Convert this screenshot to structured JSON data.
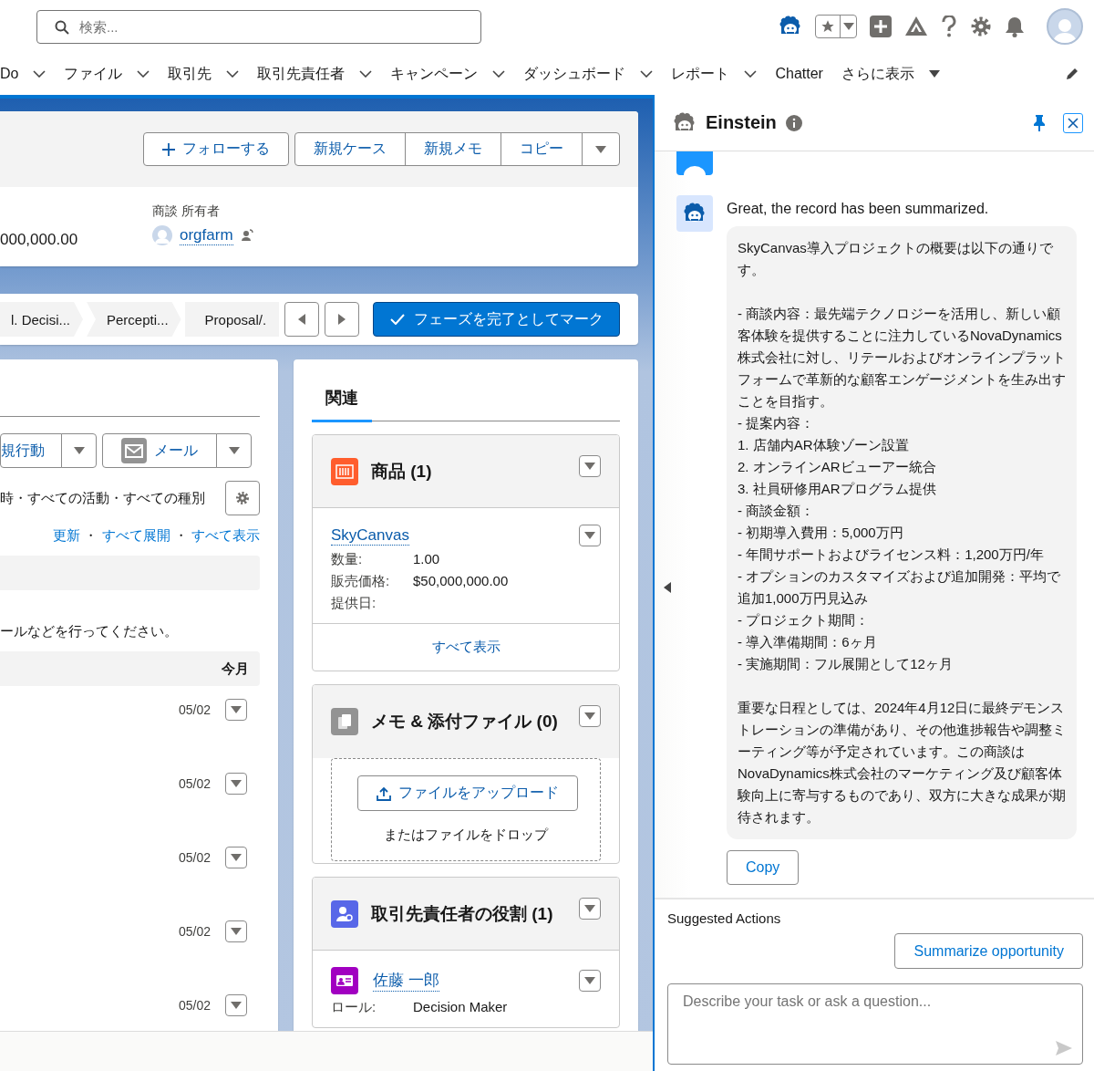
{
  "search": {
    "placeholder": "検索..."
  },
  "nav": [
    {
      "label": "Do",
      "kind": "dropdown"
    },
    {
      "label": "ファイル",
      "kind": "dropdown"
    },
    {
      "label": "取引先",
      "kind": "dropdown"
    },
    {
      "label": "取引先責任者",
      "kind": "dropdown"
    },
    {
      "label": "キャンペーン",
      "kind": "dropdown"
    },
    {
      "label": "ダッシュボード",
      "kind": "dropdown"
    },
    {
      "label": "レポート",
      "kind": "dropdown"
    },
    {
      "label": "Chatter",
      "kind": "plain"
    },
    {
      "label": "さらに表示",
      "kind": "more"
    }
  ],
  "record_actions": {
    "follow": "フォローする",
    "buttons": [
      "新規ケース",
      "新規メモ",
      "コピー"
    ]
  },
  "highlights": {
    "amount": "000,000.00",
    "owner_label": "商談 所有者",
    "owner_name": "orgfarm"
  },
  "path": {
    "stages": [
      "l. Decisi...",
      "Percepti...",
      "Proposal/."
    ],
    "mark_button": "フェーズを完了としてマーク"
  },
  "activity": {
    "buttons": [
      {
        "label": "規行動",
        "kind": "plain"
      },
      {
        "label": "メール",
        "kind": "email"
      }
    ],
    "filter": "時・すべての活動・すべての種別",
    "links": [
      "更新",
      "すべて展開",
      "すべて表示"
    ],
    "link_separators": [
      "・",
      "・"
    ],
    "empty_text": "ールなどを行ってください。",
    "group_label": "今月",
    "items": [
      "05/02",
      "05/02",
      "05/02",
      "05/02",
      "05/02"
    ]
  },
  "related": {
    "tabs": [
      {
        "label": "関連",
        "selected": true
      }
    ],
    "cards": [
      {
        "kind": "records",
        "title": "商品 (1)",
        "records": [
          {
            "name": "SkyCanvas",
            "fields": [
              {
                "label": "数量:",
                "value": "1.00"
              },
              {
                "label": "販売価格:",
                "value": "$50,000,000.00"
              },
              {
                "label": "提供日:"
              }
            ]
          }
        ],
        "footer": "すべて表示"
      },
      {
        "kind": "files",
        "title": "メモ & 添付ファイル (0)",
        "upload": "ファイルをアップロード",
        "drop_text": "またはファイルをドロップ"
      },
      {
        "kind": "records",
        "title": "取引先責任者の役割 (1)",
        "records": [
          {
            "name": "佐藤 一郎",
            "fields": [
              {
                "label": "ロール:",
                "value": "Decision Maker"
              }
            ]
          }
        ]
      }
    ]
  },
  "einstein": {
    "title": "Einstein",
    "reply": "Great, the record has been summarized.",
    "summary": [
      {
        "kind": "paragraph",
        "text": "SkyCanvas導入プロジェクトの概要は以下の通りです。"
      },
      {
        "kind": "list",
        "lines": [
          "- 商談内容：最先端テクノロジーを活用し、新しい顧客体験を提供することに注力しているNovaDynamics株式会社に対し、リテールおよびオンラインプラットフォームで革新的な顧客エンゲージメントを生み出すことを目指す。",
          "- 提案内容：",
          "1. 店舗内AR体験ゾーン設置",
          "2. オンラインARビューアー統合",
          "3. 社員研修用ARプログラム提供",
          "- 商談金額：",
          "- 初期導入費用：5,000万円",
          "- 年間サポートおよびライセンス料：1,200万円/年",
          "- オプションのカスタマイズおよび追加開発：平均で追加1,000万円見込み",
          "- プロジェクト期間：",
          "- 導入準備期間：6ヶ月",
          "- 実施期間：フル展開として12ヶ月"
        ]
      },
      {
        "kind": "paragraph",
        "text": "重要な日程としては、2024年4月12日に最終デモンストレーションの準備があり、その他進捗報告や調整ミーティング等が予定されています。この商談はNovaDynamics株式会社のマーケティング及び顧客体験向上に寄与するものであり、双方に大きな成果が期待されます。"
      }
    ],
    "copy": "Copy",
    "suggested_label": "Suggested Actions",
    "suggestions": [
      "Summarize opportunity"
    ],
    "input": {
      "placeholder": "Describe your task or ask a question..."
    }
  }
}
